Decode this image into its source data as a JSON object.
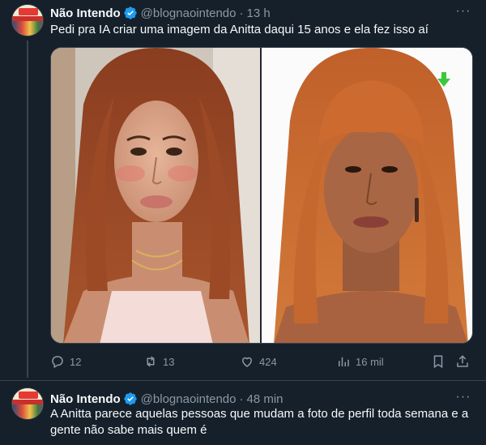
{
  "tweets": [
    {
      "author_name": "Não Intendo",
      "handle": "@blognaointendo",
      "separator": "·",
      "time": "13 h",
      "more_label": "···",
      "text": "Pedi pra IA criar uma imagem da Anitta daqui 15 anos e ela fez isso aí",
      "media": [
        {
          "icon": "photo-woman-young"
        },
        {
          "icon": "photo-woman-older",
          "badge_icon": "download-arrow-icon",
          "badge_color": "#3cc83c"
        }
      ],
      "actions": {
        "replies": "12",
        "retweets": "13",
        "likes": "424",
        "views": "16 mil"
      }
    },
    {
      "author_name": "Não Intendo",
      "handle": "@blognaointendo",
      "separator": "·",
      "time": "48 min",
      "more_label": "···",
      "text": "A Anitta parece aquelas pessoas que mudam a foto de perfil toda semana e a gente não sabe mais quem é"
    }
  ],
  "colors": {
    "background": "#15202b",
    "text": "#f7f9f9",
    "secondary": "#8b98a5",
    "verified": "#1d9bf0",
    "divider": "#38444d"
  }
}
